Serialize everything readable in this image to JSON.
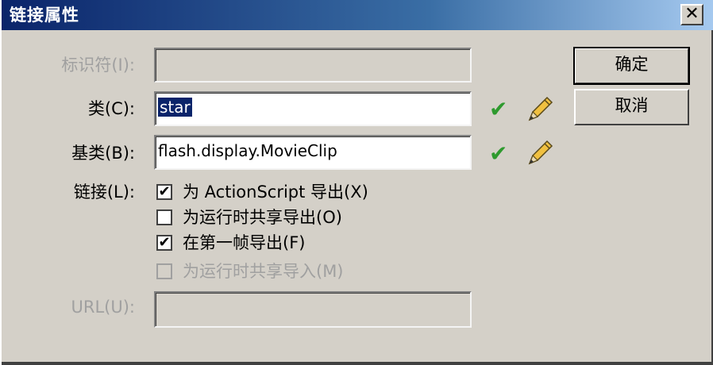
{
  "window": {
    "title": "链接属性",
    "close_glyph": "✕"
  },
  "identifier": {
    "label": "标识符(I):",
    "value": "",
    "enabled": false
  },
  "class": {
    "label": "类(C):",
    "value": "star"
  },
  "base_class": {
    "label": "基类(B):",
    "value": "flash.display.MovieClip"
  },
  "linkage": {
    "label": "链接(L):",
    "options": [
      {
        "label": "为 ActionScript 导出(X)",
        "checked": true,
        "enabled": true
      },
      {
        "label": "为运行时共享导出(O)",
        "checked": false,
        "enabled": true
      },
      {
        "label": "在第一帧导出(F)",
        "checked": true,
        "enabled": true
      },
      {
        "label": "为运行时共享导入(M)",
        "checked": false,
        "enabled": false
      }
    ]
  },
  "url": {
    "label": "URL(U):",
    "value": "",
    "enabled": false
  },
  "buttons": {
    "ok": "确定",
    "cancel": "取消"
  },
  "glyphs": {
    "validate": "✔",
    "checkmark": "✔"
  },
  "colors": {
    "validate_check": "#2e9a2e",
    "selection": "#0a246a"
  }
}
